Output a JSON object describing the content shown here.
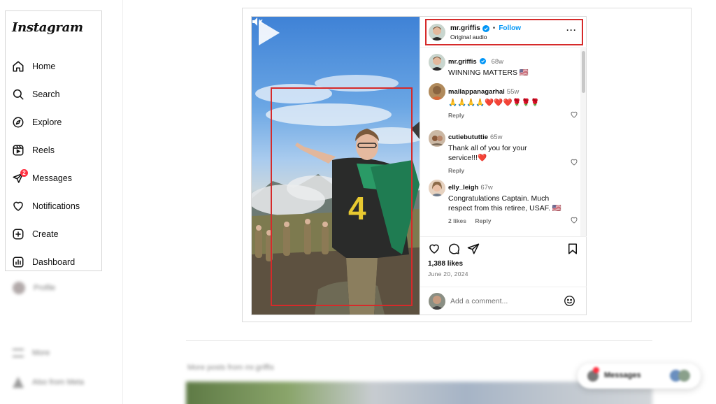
{
  "app": {
    "logo": "Instagram"
  },
  "sidebar": {
    "items": [
      {
        "label": "Home",
        "icon": "home-icon"
      },
      {
        "label": "Search",
        "icon": "search-icon"
      },
      {
        "label": "Explore",
        "icon": "compass-icon"
      },
      {
        "label": "Reels",
        "icon": "reels-icon"
      },
      {
        "label": "Messages",
        "icon": "messenger-icon",
        "badge": "2"
      },
      {
        "label": "Notifications",
        "icon": "heart-icon"
      },
      {
        "label": "Create",
        "icon": "plus-square-icon"
      },
      {
        "label": "Dashboard",
        "icon": "dashboard-icon"
      }
    ],
    "profile_label": "Profile",
    "more_label": "More",
    "also_from_meta_label": "Also from Meta"
  },
  "post": {
    "username": "mr.griffis",
    "separator": "•",
    "follow_label": "Follow",
    "audio": "Original audio",
    "more_menu": "···",
    "caption": {
      "username": "mr.griffis",
      "time": "68w",
      "text": "WINNING MATTERS 🇺🇸"
    },
    "comments": [
      {
        "username": "mallappanagarhal",
        "time": "55w",
        "text": "🙏🙏🙏🙏❤️❤️❤️🌹🌹🌹",
        "reply_label": "Reply"
      },
      {
        "username": "cutiebututtie",
        "time": "65w",
        "text": "Thank all of you for your service!!!❤️",
        "reply_label": "Reply"
      },
      {
        "username": "elly_leigh",
        "time": "67w",
        "text": "Congratulations Captain. Much respect from this retiree, USAF. 🇺🇸",
        "likes_label": "2 likes",
        "reply_label": "Reply"
      }
    ],
    "likes": "1,388 likes",
    "date": "June 20, 2024",
    "add_comment_placeholder": "Add a comment..."
  },
  "below": {
    "more_posts_label": "More posts from mr.griffis"
  },
  "messages_pill": {
    "label": "Messages"
  },
  "colors": {
    "accent": "#0095f6",
    "badge": "#ff3040",
    "highlight": "#d62a2a"
  }
}
